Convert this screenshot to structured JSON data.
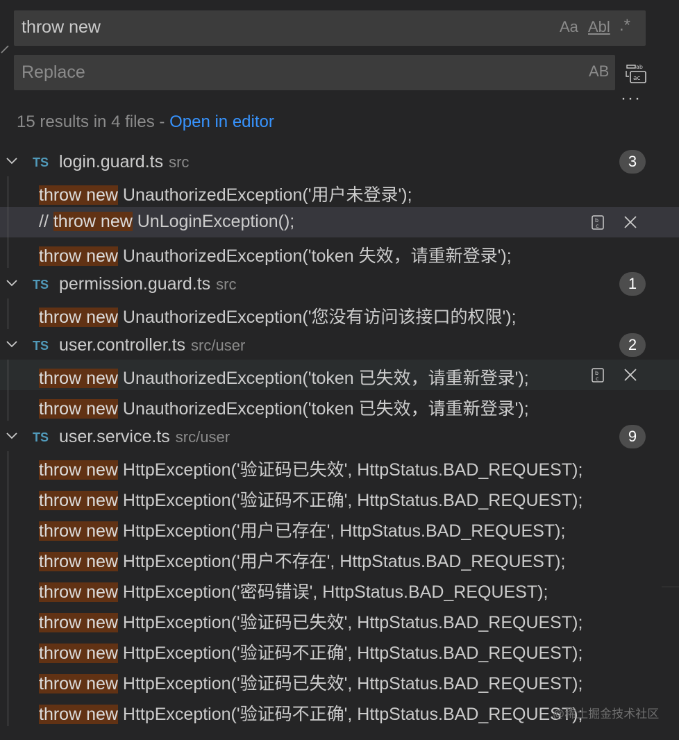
{
  "search": {
    "query": "throw new",
    "match_case_label": "Aa",
    "whole_word_label": "Abl",
    "regex_label": ".*"
  },
  "replace": {
    "placeholder": "Replace",
    "preserve_case_label": "AB",
    "more_label": "···"
  },
  "summary": {
    "text": "15 results in 4 files - ",
    "link": "Open in editor"
  },
  "files": [
    {
      "type_label": "TS",
      "name": "login.guard.ts",
      "dir": "src",
      "count": "3",
      "matches": [
        {
          "pre": "",
          "match": "throw new",
          "post": " UnauthorizedException('用户未登录');"
        },
        {
          "pre": "// ",
          "match": "throw new",
          "post": " UnLoginException();"
        },
        {
          "pre": "",
          "match": "throw new",
          "post": " UnauthorizedException('token 失效，请重新登录');"
        }
      ]
    },
    {
      "type_label": "TS",
      "name": "permission.guard.ts",
      "dir": "src",
      "count": "1",
      "matches": [
        {
          "pre": "",
          "match": "throw new",
          "post": " UnauthorizedException('您没有访问该接口的权限');"
        }
      ]
    },
    {
      "type_label": "TS",
      "name": "user.controller.ts",
      "dir": "src/user",
      "count": "2",
      "matches": [
        {
          "pre": "",
          "match": "throw new",
          "post": " UnauthorizedException('token 已失效，请重新登录');"
        },
        {
          "pre": "",
          "match": "throw new",
          "post": " UnauthorizedException('token 已失效，请重新登录');"
        }
      ]
    },
    {
      "type_label": "TS",
      "name": "user.service.ts",
      "dir": "src/user",
      "count": "9",
      "matches": [
        {
          "pre": "",
          "match": "throw new",
          "post": " HttpException('验证码已失效', HttpStatus.BAD_REQUEST);"
        },
        {
          "pre": "",
          "match": "throw new",
          "post": " HttpException('验证码不正确', HttpStatus.BAD_REQUEST);"
        },
        {
          "pre": "",
          "match": "throw new",
          "post": " HttpException('用户已存在', HttpStatus.BAD_REQUEST);"
        },
        {
          "pre": "",
          "match": "throw new",
          "post": " HttpException('用户不存在', HttpStatus.BAD_REQUEST);"
        },
        {
          "pre": "",
          "match": "throw new",
          "post": " HttpException('密码错误', HttpStatus.BAD_REQUEST);"
        },
        {
          "pre": "",
          "match": "throw new",
          "post": " HttpException('验证码已失效', HttpStatus.BAD_REQUEST);"
        },
        {
          "pre": "",
          "match": "throw new",
          "post": " HttpException('验证码不正确', HttpStatus.BAD_REQUEST);"
        },
        {
          "pre": "",
          "match": "throw new",
          "post": " HttpException('验证码已失效', HttpStatus.BAD_REQUEST);"
        },
        {
          "pre": "",
          "match": "throw new",
          "post": " HttpException('验证码不正确', HttpStatus.BAD_REQUEST);"
        }
      ]
    }
  ],
  "watermark": "@稀土掘金技术社区",
  "colors": {
    "background": "#252526",
    "input_bg": "#3c3c3c",
    "match_highlight": "#613214",
    "link": "#3794ff",
    "ts_icon": "#519aba",
    "selected_row": "#37373d"
  }
}
